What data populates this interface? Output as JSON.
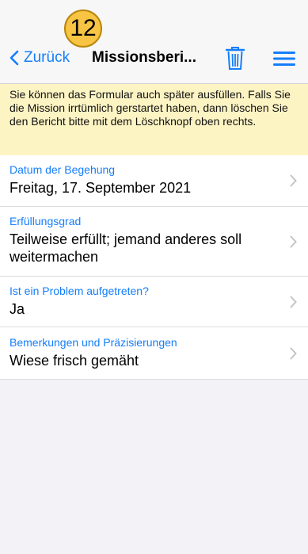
{
  "badge": "12",
  "navbar": {
    "back_label": "Zurück",
    "title": "Missionsberi..."
  },
  "banner": {
    "text": "Sie können das Formular auch später ausfüllen. Falls Sie die Mission irrtümlich gerstartet haben, dann löschen Sie den Bericht bitte mit dem Löschknopf oben rechts."
  },
  "rows": [
    {
      "label": "Datum der Begehung",
      "value": "Freitag, 17. September 2021"
    },
    {
      "label": "Erfüllungsgrad",
      "value": "Teilweise erfüllt; jemand anderes soll weitermachen"
    },
    {
      "label": "Ist ein Problem aufgetreten?",
      "value": "Ja"
    },
    {
      "label": "Bemerkungen und Präzisierungen",
      "value": "Wiese frisch gemäht"
    }
  ],
  "colors": {
    "accent": "#147efb",
    "banner": "#fdf4c4",
    "badge": "#f7c443"
  },
  "icons": [
    "chevron-left-icon",
    "trash-icon",
    "hamburger-menu-icon",
    "chevron-right-icon"
  ]
}
